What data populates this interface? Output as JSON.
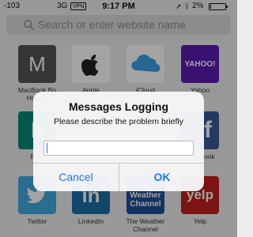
{
  "status_bar": {
    "signal": "-103",
    "network": "3G",
    "vpn": "VPN",
    "time": "9:17 PM",
    "battery_percent": "2%",
    "battery_level": 0.05
  },
  "search": {
    "placeholder": "Search or enter website name"
  },
  "favorites": [
    {
      "label": "MacBook Bo How to",
      "icon": "letter-m-icon",
      "letter": "M",
      "color": "#555555"
    },
    {
      "label": "Apple",
      "icon": "apple-logo-icon",
      "color": "#ffffff"
    },
    {
      "label": "iCloud",
      "icon": "icloud-icon",
      "color": "#ffffff"
    },
    {
      "label": "Yahoo",
      "icon": "yahoo-logo-icon",
      "logo_text": "YAHOO!",
      "color": "#5b1bb0"
    },
    {
      "label": "Bing",
      "icon": "bing-logo-icon",
      "color": "#00897b"
    },
    {
      "label": "Facebook",
      "icon": "facebook-logo-icon",
      "letter": "f",
      "color": "#3b5998"
    },
    {
      "label": "Twitter",
      "icon": "twitter-logo-icon",
      "color": "#41abe1"
    },
    {
      "label": "LinkedIn",
      "icon": "linkedin-logo-icon",
      "logo_text": "in",
      "color": "#1b6fa8"
    },
    {
      "label": "The Weather Channel",
      "icon": "weather-channel-logo-icon",
      "logo_text": "The Weather Channel",
      "color": "#1f4f99"
    },
    {
      "label": "Yelp",
      "icon": "yelp-logo-icon",
      "logo_text": "yelp",
      "color": "#c0201f"
    }
  ],
  "alert": {
    "title": "Messages Logging",
    "message": "Please describe the problem briefly",
    "input_value": "",
    "cancel_label": "Cancel",
    "ok_label": "OK"
  },
  "colors": {
    "accent": "#1a7cf4",
    "background": "#eeeef0"
  }
}
